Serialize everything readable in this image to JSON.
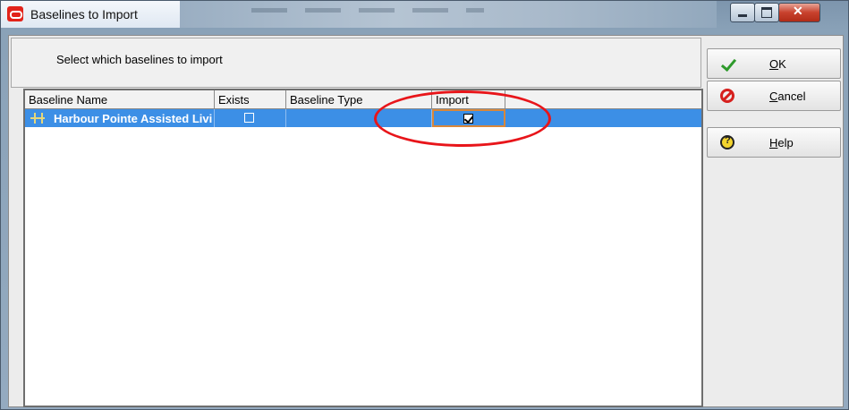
{
  "window": {
    "title": "Baselines to Import"
  },
  "prompt": "Select which baselines to import",
  "grid": {
    "columns": [
      "Baseline Name",
      "Exists",
      "Baseline Type",
      "Import"
    ],
    "rows": [
      {
        "name": "Harbour Pointe Assisted Livi",
        "exists": false,
        "type": "",
        "import": true
      }
    ]
  },
  "buttons": {
    "ok": {
      "accel": "O",
      "rest": "K"
    },
    "cancel": {
      "accel": "C",
      "rest": "ancel"
    },
    "help": {
      "accel": "H",
      "rest": "elp"
    }
  },
  "colors": {
    "selection": "#3c8fe6",
    "annotation": "#e8151a",
    "close_button": "#c8412d"
  }
}
